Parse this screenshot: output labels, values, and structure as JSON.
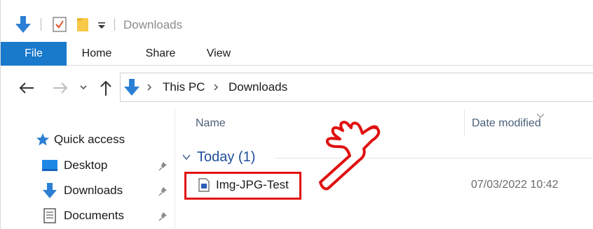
{
  "window": {
    "title": "Downloads",
    "accent_color": "#1979ca",
    "highlight_color": "#e01010"
  },
  "quick_access_toolbar": {
    "icons": [
      "download-arrow-icon",
      "properties-check-icon",
      "new-folder-icon",
      "customize-dropdown-icon"
    ]
  },
  "ribbon": {
    "tabs": [
      "File",
      "Home",
      "Share",
      "View"
    ]
  },
  "navigation": {
    "buttons": [
      "back-arrow-icon",
      "forward-arrow-icon",
      "recent-locations-icon",
      "up-arrow-icon"
    ],
    "breadcrumb": [
      "This PC",
      "Downloads"
    ]
  },
  "nav_pane": {
    "quick_access_label": "Quick access",
    "items": [
      {
        "label": "Desktop",
        "icon": "desktop-icon",
        "pinned": true
      },
      {
        "label": "Downloads",
        "icon": "downloads-icon",
        "pinned": true
      },
      {
        "label": "Documents",
        "icon": "documents-icon",
        "pinned": true
      }
    ]
  },
  "file_list": {
    "columns": [
      "Name",
      "Date modified"
    ],
    "groups": [
      {
        "title": "Today (1)",
        "files": [
          {
            "name": "Img-JPG-Test",
            "date_modified": "07/03/2022 10:42",
            "icon": "image-file-icon"
          }
        ]
      }
    ]
  },
  "annotation": {
    "icon": "pointing-hand-icon"
  }
}
